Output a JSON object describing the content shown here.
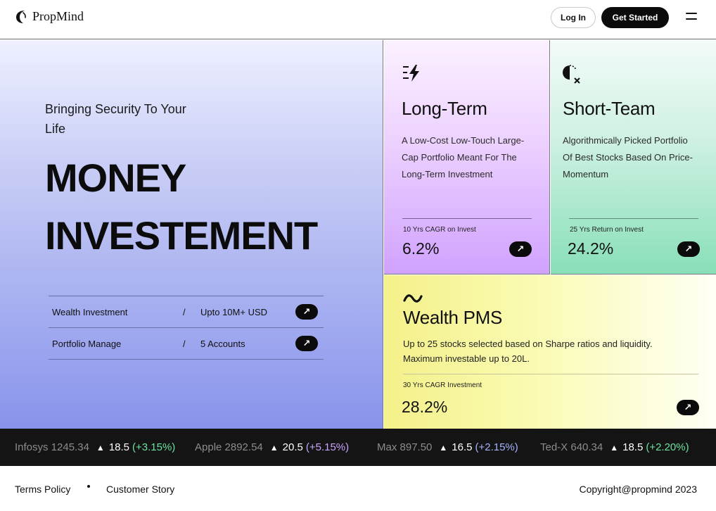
{
  "header": {
    "logo_text": "PropMind",
    "login_label": "Log In",
    "get_started_label": "Get Started"
  },
  "hero": {
    "tagline": "Bringing Security To Your Life",
    "headline_line1": "MONEY",
    "headline_line2": "INVESTEMENT",
    "offers": [
      {
        "name": "Wealth Investment",
        "separator": "/",
        "value": "Upto 10M+ USD",
        "arrow": "↗"
      },
      {
        "name": "Portfolio Manage",
        "separator": "/",
        "value": "5 Accounts",
        "arrow": "↗"
      }
    ]
  },
  "cards": {
    "long_term": {
      "icon": "lightning-speed-icon",
      "title": "Long-Term",
      "description": "A Low-Cost Low-Touch Large-Cap Portfolio Meant For The Long-Term Investment",
      "stat_label": "10 Yrs CAGR on Invest",
      "stat_value": "6.2%",
      "arrow": "↗",
      "color": "#d0a2ff"
    },
    "short_team": {
      "icon": "half-moon-cross-icon",
      "title": "Short-Team",
      "description": "Algorithmically Picked Portfolio Of Best Stocks Based On Price-Momentum",
      "stat_label": "25 Yrs Return on Invest",
      "stat_value": "24.2%",
      "arrow": "↗",
      "color": "#88dfb8"
    },
    "wealth_pms": {
      "icon": "tilde-wave-icon",
      "title": "Wealth PMS",
      "description": "Up to 25 stocks selected based on Sharpe ratios and liquidity. Maximum investable up to 20L.",
      "stat_label": "30 Yrs CAGR Investment",
      "stat_value": "28.2%",
      "arrow": "↗",
      "color": "#f4f08a"
    }
  },
  "ticker": [
    {
      "name": "Infosys 1245.34",
      "arrow": "▲",
      "delta": "18.5",
      "pct": "(+3.15%)",
      "pct_color": "#6be39e"
    },
    {
      "name": "Apple 2892.54",
      "arrow": "▲",
      "delta": "20.5",
      "pct": "(+5.15%)",
      "pct_color": "#c9a4ff"
    },
    {
      "name": "Max 897.50",
      "arrow": "▲",
      "delta": "16.5",
      "pct": "(+2.15%)",
      "pct_color": "#a7b3ff"
    },
    {
      "name": "Ted-X 640.34",
      "arrow": "▲",
      "delta": "18.5",
      "pct": "(+2.20%)",
      "pct_color": "#6be39e"
    }
  ],
  "footer": {
    "terms_label": "Terms Policy",
    "customer_story_label": "Customer Story",
    "copyright": "Copyright@propmind 2023"
  }
}
